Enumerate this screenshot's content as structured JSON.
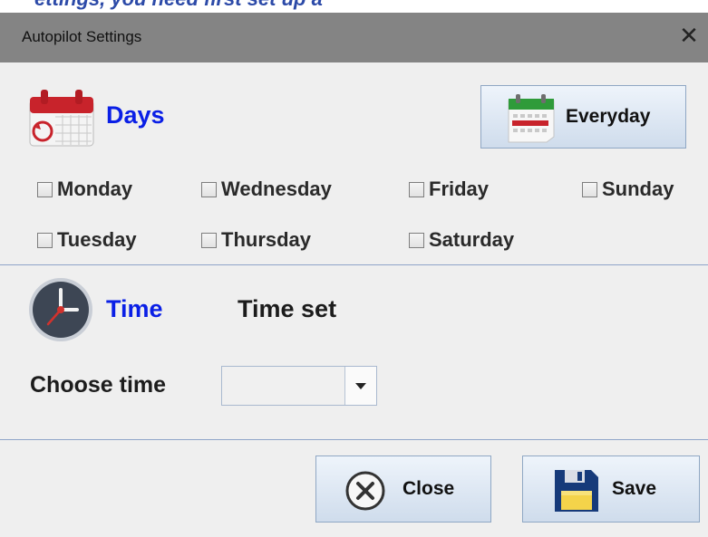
{
  "top_strip_text": "ettings, you need first set up a",
  "window": {
    "title": "Autopilot Settings",
    "close_glyph": "✕"
  },
  "days": {
    "label": "Days",
    "everyday_label": "Everyday",
    "checkboxes": [
      {
        "label": "Monday",
        "checked": false
      },
      {
        "label": "Wednesday",
        "checked": false
      },
      {
        "label": "Friday",
        "checked": false
      },
      {
        "label": "Sunday",
        "checked": false
      },
      {
        "label": "Tuesday",
        "checked": false
      },
      {
        "label": "Thursday",
        "checked": false
      },
      {
        "label": "Saturday",
        "checked": false
      }
    ]
  },
  "time": {
    "label": "Time",
    "time_set_label": "Time set",
    "choose_label": "Choose time",
    "combo_value": ""
  },
  "actions": {
    "close_label": "Close",
    "save_label": "Save"
  },
  "icons": [
    "calendar-icon",
    "clock-icon",
    "calendar-grid-icon",
    "close-circle-icon",
    "floppy-disk-icon",
    "dropdown-arrow-icon"
  ],
  "colors": {
    "section_label": "#0a1fe6",
    "titlebar": "#848484",
    "background": "#efefef",
    "separator": "#8ea4c8"
  }
}
